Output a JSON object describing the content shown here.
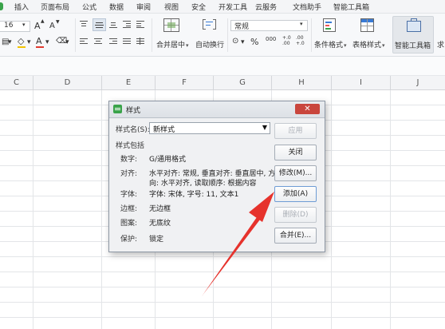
{
  "menu": {
    "items": [
      "插入",
      "页面布局",
      "公式",
      "数据",
      "审阅",
      "视图",
      "安全",
      "开发工具",
      "云服务",
      "文档助手",
      "智能工具箱"
    ]
  },
  "ribbon": {
    "font_size": "16",
    "font_size_up": "A",
    "font_size_down": "A",
    "font_color_letter": "A",
    "merge_center": "合并居中",
    "wrap_text": "自动换行",
    "number_format": "常规",
    "percent": "%",
    "thousands": "000",
    "inc_decimal": "+.0\n.00",
    "dec_decimal": ".00\n+.0",
    "conditional_format": "条件格式",
    "table_style": "表格样式",
    "smart_toolbox": "智能工具箱",
    "more": "求"
  },
  "sheet": {
    "columns": [
      "C",
      "D",
      "E",
      "F",
      "G",
      "H",
      "I",
      "J"
    ]
  },
  "dialog": {
    "title": "样式",
    "close_symbol": "✕",
    "style_name_label": "样式名(S):",
    "style_name_value": "新样式",
    "includes_label": "样式包括",
    "rows": [
      {
        "label": "数字:",
        "value": "G/通用格式"
      },
      {
        "label": "对齐:",
        "value": "水平对齐: 常规, 垂直对齐: 垂直居中, 方"
      },
      {
        "label": "",
        "value": "向: 水平对齐, 读取顺序: 根据内容"
      },
      {
        "label": "字体:",
        "value": "字体: 宋体, 字号: 11, 文本1"
      },
      {
        "label": "边框:",
        "value": "无边框"
      },
      {
        "label": "图案:",
        "value": "无底纹"
      },
      {
        "label": "保护:",
        "value": "锁定"
      }
    ],
    "buttons": {
      "apply": "应用",
      "close": "关闭",
      "modify": "修改(M)...",
      "add": "添加(A)",
      "delete": "删除(D)",
      "merge": "合并(E)..."
    }
  },
  "colors": {
    "accent_green": "#3aa34a",
    "close_red": "#c9463d",
    "arrow_red": "#e6322c",
    "font_color_bar": "#e03a2f",
    "highlight_bar": "#f2c200"
  }
}
